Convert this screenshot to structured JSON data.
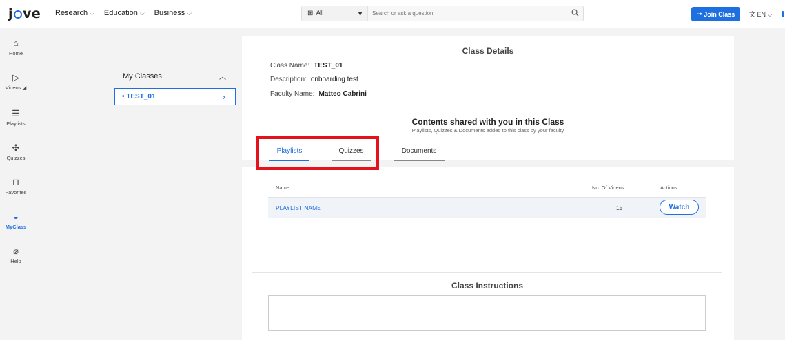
{
  "header": {
    "logo": "jove",
    "nav": [
      {
        "label": "Research"
      },
      {
        "label": "Education"
      },
      {
        "label": "Business"
      }
    ],
    "search": {
      "scope": "All",
      "placeholder": "Search or ask a question"
    },
    "join_label": "Join Class",
    "language": "EN"
  },
  "sidebar": {
    "items": [
      {
        "label": "Home",
        "icon": "home-icon"
      },
      {
        "label": "Videos",
        "icon": "video-icon"
      },
      {
        "label": "Playlists",
        "icon": "playlist-icon"
      },
      {
        "label": "Quizzes",
        "icon": "puzzle-icon"
      },
      {
        "label": "Favorites",
        "icon": "bookmark-icon"
      },
      {
        "label": "MyClass",
        "icon": "graduation-cap-icon",
        "active": true
      },
      {
        "label": "Help",
        "icon": "help-icon"
      }
    ]
  },
  "my_classes": {
    "title": "My Classes",
    "items": [
      {
        "label": "TEST_01"
      }
    ]
  },
  "class_details": {
    "title": "Class Details",
    "name_label": "Class Name:",
    "name_value": "TEST_01",
    "description_label": "Description:",
    "description_value": "onboarding test",
    "faculty_label": "Faculty Name:",
    "faculty_value": "Matteo Cabrini"
  },
  "shared": {
    "title": "Contents shared with you in this Class",
    "subtitle": "Playlists, Quizzes & Documents added to this class by your faculty",
    "tabs": [
      {
        "label": "Playlists",
        "active": true
      },
      {
        "label": "Quizzes"
      },
      {
        "label": "Documents"
      }
    ]
  },
  "table": {
    "headers": {
      "name": "Name",
      "videos": "No. Of Videos",
      "actions": "Actions"
    },
    "rows": [
      {
        "name": "PLAYLIST NAME",
        "videos": "15",
        "action": "Watch"
      }
    ]
  },
  "instructions": {
    "title": "Class Instructions"
  },
  "colors": {
    "accent": "#1e6fe0",
    "highlight": "#e3121b"
  }
}
